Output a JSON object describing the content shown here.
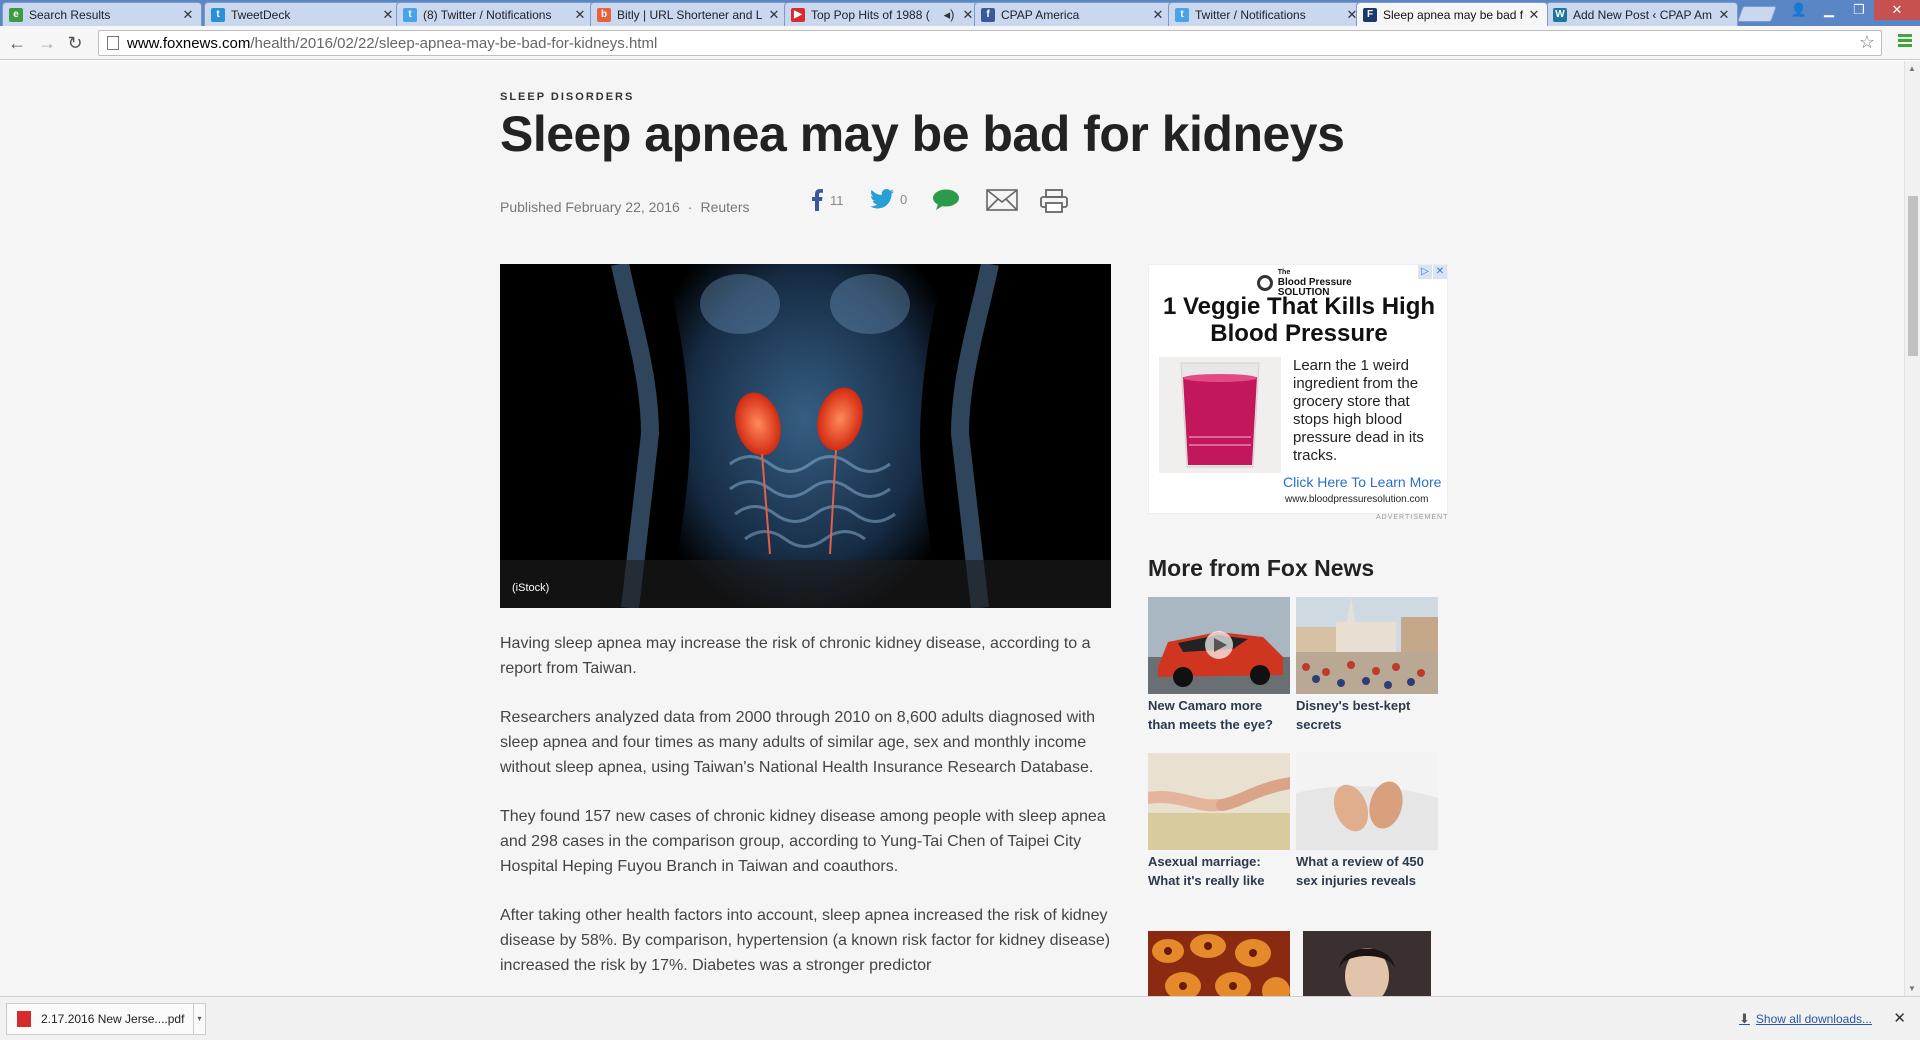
{
  "tabs": [
    {
      "title": "Search Results",
      "favicon": "evernote-icon",
      "color": "#3f9b3f"
    },
    {
      "title": "TweetDeck",
      "favicon": "tweetdeck-icon",
      "color": "#2a8fd6"
    },
    {
      "title": "(8) Twitter / Notifications",
      "favicon": "twitter-icon",
      "color": "#4aa3e8"
    },
    {
      "title": "Bitly | URL Shortener and L",
      "favicon": "bitly-icon",
      "color": "#e8603c"
    },
    {
      "title": "Top Pop Hits of 1988 (",
      "favicon": "youtube-icon",
      "color": "#d92b2b"
    },
    {
      "title": "CPAP America",
      "favicon": "facebook-icon",
      "color": "#3b5998"
    },
    {
      "title": "Twitter / Notifications",
      "favicon": "twitter-icon",
      "color": "#4aa3e8"
    },
    {
      "title": "Sleep apnea may be bad f",
      "favicon": "fox-icon",
      "color": "#1a3a6a"
    },
    {
      "title": "Add New Post ‹ CPAP Am",
      "favicon": "wordpress-icon",
      "color": "#21759b"
    }
  ],
  "address": {
    "host": "www.foxnews.com",
    "path": "/health/2016/02/22/sleep-apnea-may-be-bad-for-kidneys.html"
  },
  "article": {
    "kicker": "SLEEP DISORDERS",
    "headline": "Sleep apnea may be bad for kidneys",
    "published": "Published February 22, 2016",
    "source": "Reuters",
    "facebook_count": "11",
    "twitter_count": "0",
    "image_caption": "(iStock)",
    "paragraphs": [
      "Having sleep apnea may increase the risk of chronic kidney disease, according to a report from Taiwan.",
      "Researchers analyzed data from 2000 through 2010 on 8,600 adults diagnosed with sleep apnea and four times as many adults of similar age, sex and monthly income without sleep apnea, using Taiwan's National Health Insurance Research Database.",
      "They found 157 new cases of chronic kidney disease among people with sleep apnea and 298 cases in the comparison group, according to Yung-Tai Chen of Taipei City Hospital Heping Fuyou Branch in Taiwan and coauthors.",
      "After taking other health factors into account, sleep apnea increased the risk of kidney disease by 58%. By comparison, hypertension (a known risk factor for kidney disease) increased the risk by 17%. Diabetes was a stronger predictor"
    ]
  },
  "ad": {
    "brand_line1": "The",
    "brand_line2": "Blood Pressure",
    "brand_line3": "SOLUTION",
    "headline": "1 Veggie That Kills High Blood Pressure",
    "copy": "Learn the 1 weird ingredient from the grocery store that stops high blood pressure dead in its tracks.",
    "cta": "Click Here To Learn More",
    "url": "www.bloodpressuresolution.com",
    "label": "ADVERTISEMENT"
  },
  "more": {
    "title": "More from Fox News",
    "items": [
      {
        "caption": "New Camaro more than meets the eye?"
      },
      {
        "caption": "Disney's best-kept secrets"
      },
      {
        "caption": "Asexual marriage: What it's really like"
      },
      {
        "caption": "What a review of 450 sex injuries reveals"
      },
      {
        "caption": ""
      },
      {
        "caption": ""
      }
    ]
  },
  "downloads": {
    "file": "2.17.2016 New Jerse....pdf",
    "show_all": "Show all downloads..."
  }
}
